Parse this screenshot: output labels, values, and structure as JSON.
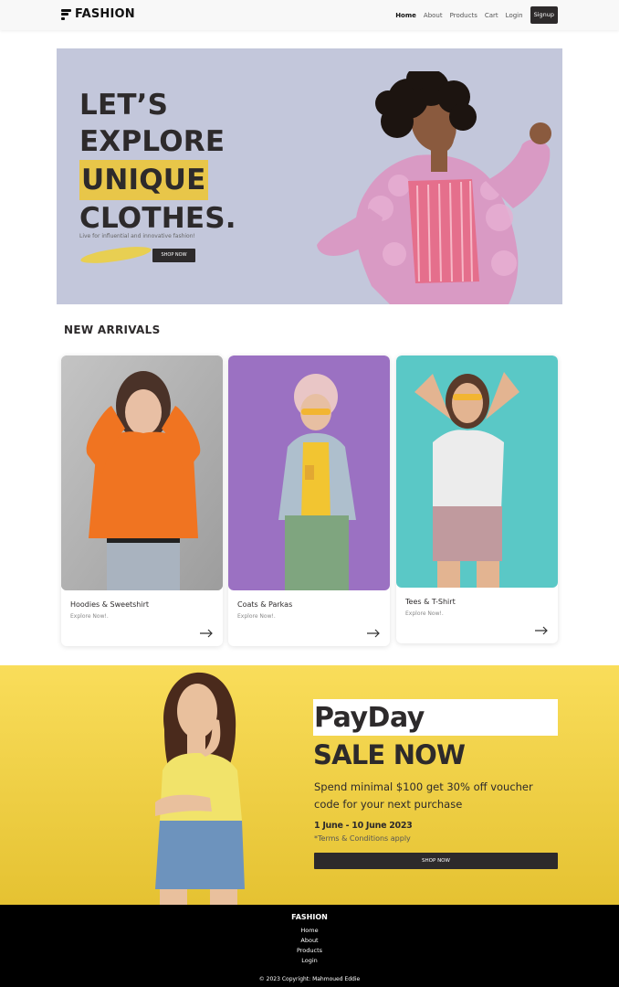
{
  "navbar": {
    "brand": "FASHION",
    "links": [
      "Home",
      "About",
      "Products",
      "Cart",
      "Login"
    ],
    "active": "Home",
    "signup": "Signup"
  },
  "hero": {
    "title_lines": [
      "LET’S",
      "EXPLORE",
      "UNIQUE",
      "CLOTHES."
    ],
    "highlight_word": "UNIQUE",
    "subtitle": "Live for influential and innovative fashion!",
    "button": "SHOP NOW",
    "background": "#c3c7db",
    "highlight_color": "#e8c649"
  },
  "arrivals": {
    "title": "NEW ARRIVALS",
    "cards": [
      {
        "title": "Hoodies & Sweetshirt",
        "subtitle": "Explore Now!."
      },
      {
        "title": "Coats & Parkas",
        "subtitle": "Explore Now!."
      },
      {
        "title": "Tees & T-Shirt",
        "subtitle": "Explore Now!."
      }
    ]
  },
  "sale": {
    "headline": "PayDay",
    "subheadline": "SALE NOW",
    "description": "Spend minimal $100 get 30% off voucher code for your next purchase",
    "dates": "1 June - 10 June 2023",
    "terms": "*Terms & Conditions apply",
    "button": "SHOP NOW",
    "background": "#f9dd5a"
  },
  "footer": {
    "brand": "FASHION",
    "links": [
      "Home",
      "About",
      "Products",
      "Login"
    ],
    "copyright": "© 2023 Copyright: Mahmoued Eddie"
  }
}
